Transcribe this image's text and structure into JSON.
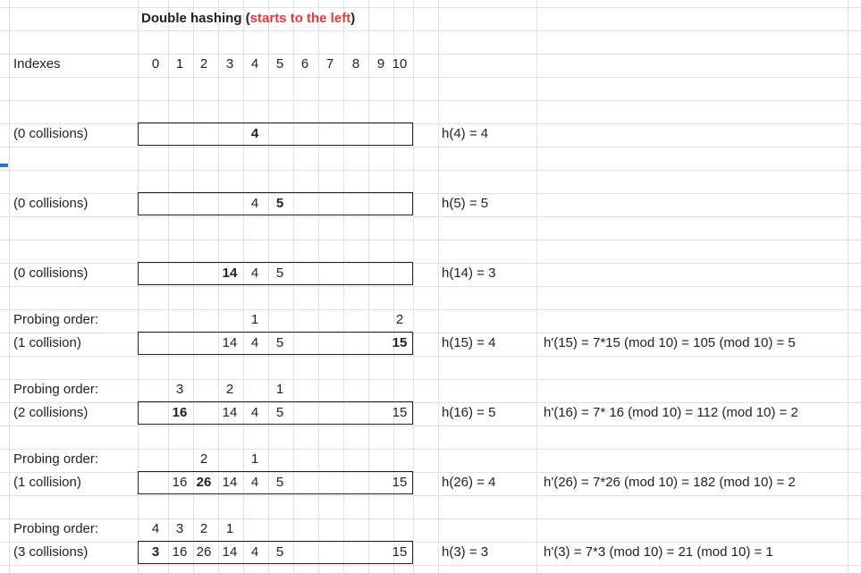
{
  "title": {
    "prefix": "Double hashing (",
    "highlight": "starts to the left",
    "suffix": ")"
  },
  "indexes": {
    "label": "Indexes",
    "values": [
      "0",
      "1",
      "2",
      "3",
      "4",
      "5",
      "6",
      "7",
      "8",
      "9",
      "10"
    ]
  },
  "rows": [
    {
      "label": "(0 collisions)",
      "hash": "h(4) = 4",
      "secondary": "",
      "probe": [],
      "cells": [
        {
          "col": "4",
          "text": "4",
          "bold": true
        }
      ]
    },
    {
      "label": "(0 collisions)",
      "hash": "h(5) = 5",
      "secondary": "",
      "probe": [],
      "cells": [
        {
          "col": "4",
          "text": "4",
          "bold": false
        },
        {
          "col": "5",
          "text": "5",
          "bold": true
        }
      ]
    },
    {
      "label": "(0 collisions)",
      "hash": "h(14) = 3",
      "secondary": "",
      "probe": [],
      "cells": [
        {
          "col": "3",
          "text": "14",
          "bold": true
        },
        {
          "col": "4",
          "text": "4",
          "bold": false
        },
        {
          "col": "5",
          "text": "5",
          "bold": false
        }
      ]
    },
    {
      "probe_label": "Probing order:",
      "label": "(1 collision)",
      "hash": "h(15) = 4",
      "secondary": "h'(15) = 7*15 (mod 10) = 105 (mod 10) = 5",
      "probe": [
        {
          "col": "4",
          "text": "1"
        },
        {
          "col": "10",
          "text": "2"
        }
      ],
      "cells": [
        {
          "col": "3",
          "text": "14",
          "bold": false
        },
        {
          "col": "4",
          "text": "4",
          "bold": false
        },
        {
          "col": "5",
          "text": "5",
          "bold": false
        },
        {
          "col": "10",
          "text": "15",
          "bold": true
        }
      ]
    },
    {
      "probe_label": "Probing order:",
      "label": "(2 collisions)",
      "hash": "h(16) = 5",
      "secondary": "h'(16) = 7* 16 (mod 10) = 112 (mod 10) = 2",
      "probe": [
        {
          "col": "1",
          "text": "3"
        },
        {
          "col": "3",
          "text": "2"
        },
        {
          "col": "5",
          "text": "1"
        }
      ],
      "cells": [
        {
          "col": "1",
          "text": "16",
          "bold": true
        },
        {
          "col": "3",
          "text": "14",
          "bold": false
        },
        {
          "col": "4",
          "text": "4",
          "bold": false
        },
        {
          "col": "5",
          "text": "5",
          "bold": false
        },
        {
          "col": "10",
          "text": "15",
          "bold": false
        }
      ]
    },
    {
      "probe_label": "Probing order:",
      "label": "(1 collision)",
      "hash": "h(26) = 4",
      "secondary": "h'(26) = 7*26 (mod 10) = 182 (mod 10) = 2",
      "probe": [
        {
          "col": "2",
          "text": "2"
        },
        {
          "col": "4",
          "text": "1"
        }
      ],
      "cells": [
        {
          "col": "1",
          "text": "16",
          "bold": false
        },
        {
          "col": "2",
          "text": "26",
          "bold": true
        },
        {
          "col": "3",
          "text": "14",
          "bold": false
        },
        {
          "col": "4",
          "text": "4",
          "bold": false
        },
        {
          "col": "5",
          "text": "5",
          "bold": false
        },
        {
          "col": "10",
          "text": "15",
          "bold": false
        }
      ]
    },
    {
      "probe_label": "Probing order:",
      "label": "(3 collisions)",
      "hash": "h(3) = 3",
      "secondary": "h'(3) = 7*3 (mod 10) = 21 (mod 10) = 1",
      "probe": [
        {
          "col": "0",
          "text": "4"
        },
        {
          "col": "1",
          "text": "3"
        },
        {
          "col": "2",
          "text": "2"
        },
        {
          "col": "3",
          "text": "1"
        }
      ],
      "cells": [
        {
          "col": "0",
          "text": "3",
          "bold": true
        },
        {
          "col": "1",
          "text": "16",
          "bold": false
        },
        {
          "col": "2",
          "text": "26",
          "bold": false
        },
        {
          "col": "3",
          "text": "14",
          "bold": false
        },
        {
          "col": "4",
          "text": "4",
          "bold": false
        },
        {
          "col": "5",
          "text": "5",
          "bold": false
        },
        {
          "col": "10",
          "text": "15",
          "bold": false
        }
      ]
    }
  ]
}
